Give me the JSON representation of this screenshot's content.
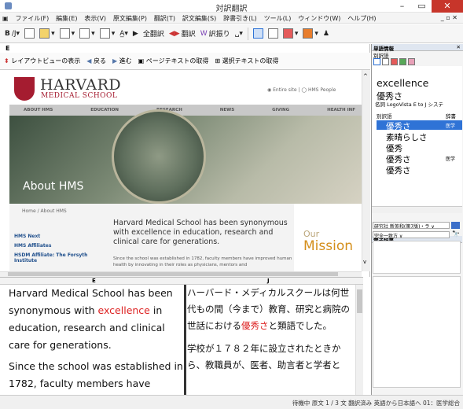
{
  "window": {
    "title": "対訳翻訳"
  },
  "menu": [
    "ファイル(F)",
    "編集(E)",
    "表示(V)",
    "原文編集(P)",
    "翻訳(T)",
    "訳文編集(S)",
    "辞書引き(L)",
    "ツール(L)",
    "ウィンドウ(W)",
    "ヘルプ(H)"
  ],
  "toolbar": {
    "full_translate": "全翻訳",
    "translate": "翻訳",
    "dictionary_lookup": "訳振り"
  },
  "browser": {
    "pane_label": "E",
    "show_layout": "レイアウトビューの表示",
    "back": "戻る",
    "forward": "進む",
    "get_page_text": "ページテキストの取得",
    "get_selected_text": "選択テキストの取得"
  },
  "site": {
    "logo_name": "HARVARD",
    "logo_sub": "MEDICAL SCHOOL",
    "search_options": "◉ Entire site  |  ◯ HMS People",
    "nav": [
      "ABOUT HMS",
      "EDUCATION",
      "RESEARCH",
      "NEWS",
      "GIVING",
      "HEALTH INF"
    ],
    "hero_title": "About HMS",
    "breadcrumb": "Home / About HMS",
    "side_links": [
      "HMS Next",
      "HMS Affiliates",
      "HSDM Affiliate: The Forsyth Institute"
    ],
    "intro_head": "Harvard Medical School has been synonymous with excellence in education, research and clinical care for generations.",
    "intro_body": "Since the school was established in 1782, faculty members have improved human health by innovating in their roles as physicians, mentors and",
    "mission_our": "Our",
    "mission_word": "Mission"
  },
  "editor": {
    "source_label": "E",
    "target_label": "J",
    "source_p1_pre": "Harvard Medical School has been synonymous with ",
    "source_p1_hl": "excellence",
    "source_p1_post": " in education, research and clinical care for generations.",
    "source_p2": "Since the school was established in 1782, faculty members have",
    "target_p1_pre": "ハーバード・メディカルスクールは何世代もの間（今まで）教育、研究と病院の世話における",
    "target_p1_hl": "優秀さ",
    "target_p1_post": "と類語でした。",
    "target_p2": "学校が１７８２年に設立されたときから、教職員が、医者、助言者と学者と"
  },
  "word_info": {
    "panel_title": "単語情報",
    "tab": "別訳語",
    "headword": "excellence",
    "reading": "優秀さ",
    "pos": "名詞  LogoVista E to J システ",
    "columns": [
      "別訳語",
      "辞書"
    ],
    "candidates": [
      {
        "word": "優秀さ",
        "dict": "医学",
        "selected": true
      },
      {
        "word": "素晴らしさ",
        "dict": "",
        "selected": false
      },
      {
        "word": "優秀",
        "dict": "",
        "selected": false
      },
      {
        "word": "優秀さ",
        "dict": "医学",
        "selected": false
      },
      {
        "word": "優秀さ",
        "dict": "",
        "selected": false
      }
    ]
  },
  "dictionary": {
    "panel_title": "電子辞書",
    "selected_dict": "研究社 新英和(第7版)・ラ ∨",
    "match_mode": "完全一致方 ∨"
  },
  "status": "待機中  原文  1 / 3 文  翻訳済み  英語から日本語へ  01：医学総合"
}
